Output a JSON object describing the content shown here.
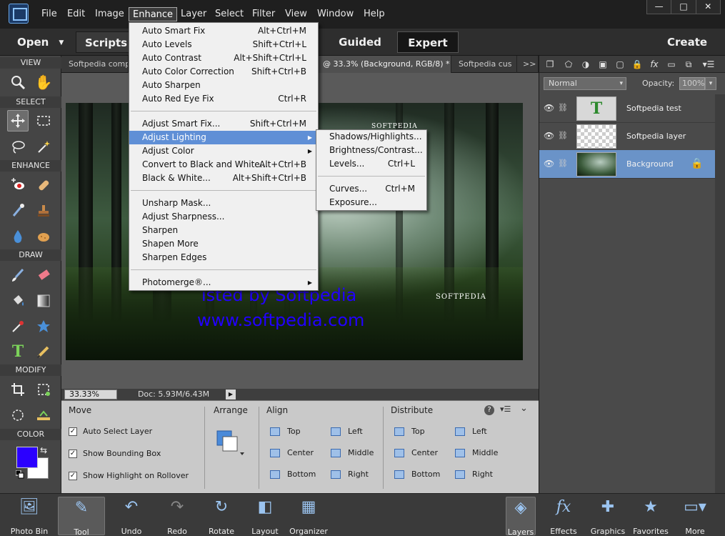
{
  "menubar": {
    "items": [
      "File",
      "Edit",
      "Image",
      "Enhance",
      "Layer",
      "Select",
      "Filter",
      "View",
      "Window",
      "Help"
    ],
    "window_controls": [
      "—",
      "□",
      "✕"
    ]
  },
  "toolbar": {
    "open": "Open",
    "scripts": "Scripts",
    "guided": "Guided",
    "expert": "Expert",
    "create": "Create"
  },
  "tools": {
    "sections": [
      "VIEW",
      "SELECT",
      "ENHANCE",
      "DRAW",
      "MODIFY",
      "COLOR"
    ]
  },
  "colors": {
    "foreground": "#2b00ff",
    "background": "#ffffff",
    "accent": "#5f8fd6"
  },
  "tabs": [
    "Softpedia comp",
    "@ 33.3% (Background, RGB/8) *",
    "Softpedia cus"
  ],
  "tab_close": "×",
  "tab_overflow": ">>",
  "canvas": {
    "watermark_line1": "ısted by Softpedia",
    "watermark_line2": "www.softpedia.com",
    "logo_bottom": "SOFTPEDIA",
    "logo_top": "SOFTPEDIA"
  },
  "status": {
    "zoom": "33.33%",
    "doc": "Doc: 5.93M/6.43M"
  },
  "options": {
    "move_title": "Move",
    "checkboxes": [
      "Auto Select Layer",
      "Show Bounding Box",
      "Show Highlight on Rollover"
    ],
    "arrange_title": "Arrange",
    "align_title": "Align",
    "align": [
      "Top",
      "Center",
      "Bottom",
      "Left",
      "Middle",
      "Right"
    ],
    "distribute_title": "Distribute",
    "distribute": [
      "Top",
      "Center",
      "Bottom",
      "Left",
      "Middle",
      "Right"
    ],
    "help": "?"
  },
  "layers_panel": {
    "blend_mode": "Normal",
    "opacity_label": "Opacity:",
    "opacity": "100%",
    "layers": [
      "Softpedia test",
      "Softpedia layer",
      "Background"
    ]
  },
  "bottombar": [
    "Photo Bin",
    "Tool Options",
    "Undo",
    "Redo",
    "Rotate",
    "Layout",
    "Organizer",
    "Layers",
    "Effects",
    "Graphics",
    "Favorites",
    "More"
  ],
  "enhance_menu": [
    {
      "label": "Auto Smart Fix",
      "shortcut": "Alt+Ctrl+M"
    },
    {
      "label": "Auto Levels",
      "shortcut": "Shift+Ctrl+L"
    },
    {
      "label": "Auto Contrast",
      "shortcut": "Alt+Shift+Ctrl+L"
    },
    {
      "label": "Auto Color Correction",
      "shortcut": "Shift+Ctrl+B"
    },
    {
      "label": "Auto Sharpen",
      "shortcut": ""
    },
    {
      "label": "Auto Red Eye Fix",
      "shortcut": "Ctrl+R"
    },
    {
      "label": "Adjust Smart Fix...",
      "shortcut": "Shift+Ctrl+M"
    },
    {
      "label": "Adjust Lighting",
      "shortcut": ""
    },
    {
      "label": "Adjust Color",
      "shortcut": ""
    },
    {
      "label": "Convert to Black and White...",
      "shortcut": "Alt+Ctrl+B"
    },
    {
      "label": "Black & White...",
      "shortcut": "Alt+Shift+Ctrl+B"
    },
    {
      "label": "Unsharp Mask...",
      "shortcut": ""
    },
    {
      "label": "Adjust Sharpness...",
      "shortcut": ""
    },
    {
      "label": "Sharpen",
      "shortcut": ""
    },
    {
      "label": "Shapen More",
      "shortcut": ""
    },
    {
      "label": "Sharpen Edges",
      "shortcut": ""
    },
    {
      "label": "Photomerge®...",
      "shortcut": ""
    }
  ],
  "lighting_submenu": [
    {
      "label": "Shadows/Highlights...",
      "shortcut": ""
    },
    {
      "label": "Brightness/Contrast...",
      "shortcut": ""
    },
    {
      "label": "Levels...",
      "shortcut": "Ctrl+L"
    },
    {
      "label": "Curves...",
      "shortcut": "Ctrl+M"
    },
    {
      "label": "Exposure...",
      "shortcut": ""
    }
  ]
}
